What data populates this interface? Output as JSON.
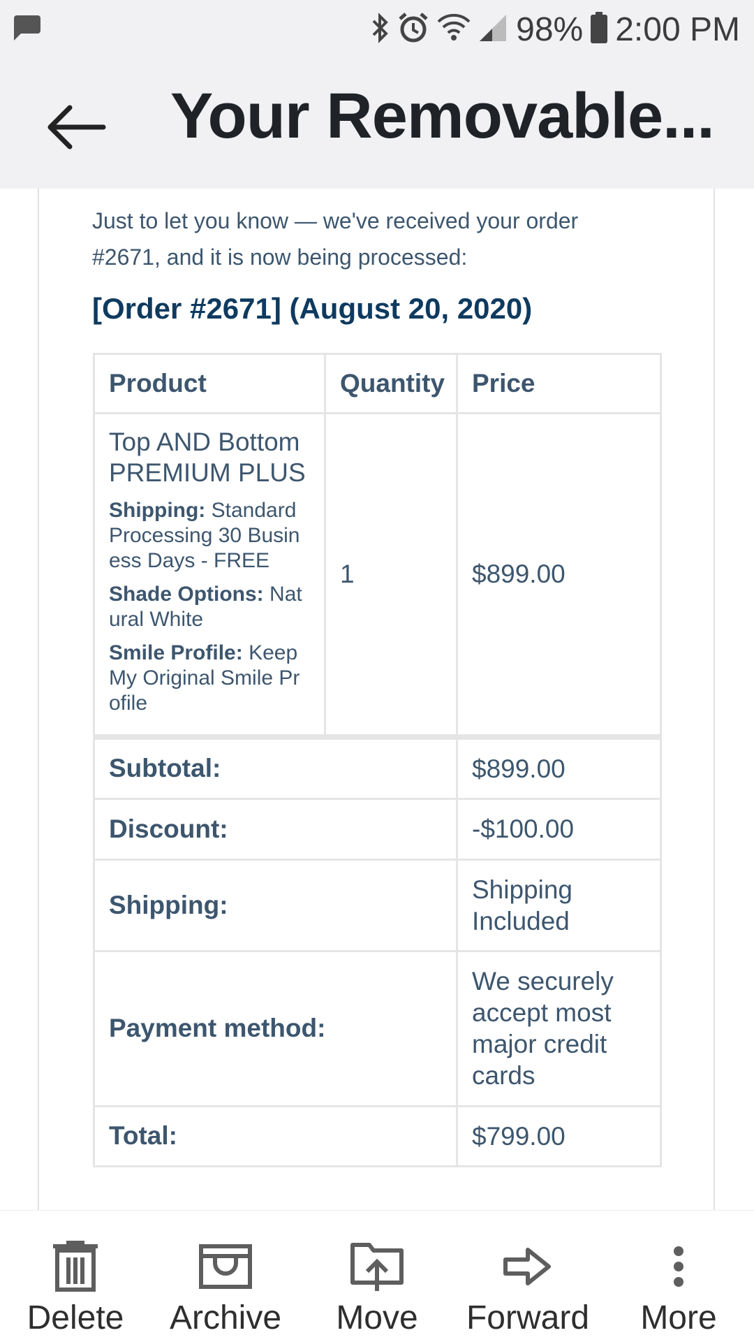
{
  "status_bar": {
    "battery": "98%",
    "time": "2:00 PM",
    "icons": [
      "message-icon",
      "bluetooth-icon",
      "alarm-icon",
      "wifi-icon",
      "signal-icon",
      "battery-icon"
    ]
  },
  "app_bar": {
    "title": "Your Removable..."
  },
  "email": {
    "intro": "Just to let you know — we've received your order #2671, and it is now being processed:",
    "order_heading": "[Order #2671] (August 20, 2020)",
    "table": {
      "headers": {
        "product": "Product",
        "quantity": "Quantity",
        "price": "Price"
      },
      "item": {
        "name": "Top AND Bottom PREMIUM PLUS",
        "meta": [
          {
            "label": "Shipping:",
            "value": "Standard Processing 30 Business Days - FREE"
          },
          {
            "label": "Shade Options:",
            "value": "Natural White"
          },
          {
            "label": "Smile Profile:",
            "value": "Keep My Original Smile Profile"
          }
        ],
        "quantity": "1",
        "price": "$899.00"
      },
      "totals": [
        {
          "label": "Subtotal:",
          "value": "$899.00"
        },
        {
          "label": "Discount:",
          "value": "-$100.00"
        },
        {
          "label": "Shipping:",
          "value": "Shipping Included"
        },
        {
          "label": "Payment method:",
          "value": "We securely accept most major credit cards"
        },
        {
          "label": "Total:",
          "value": "$799.00"
        }
      ]
    }
  },
  "toolbar": {
    "delete": "Delete",
    "archive": "Archive",
    "move": "Move",
    "forward": "Forward",
    "more": "More"
  },
  "colors": {
    "text": "#3d566e",
    "heading": "#0e3a5f",
    "bar_bg": "#f1f1f4"
  }
}
